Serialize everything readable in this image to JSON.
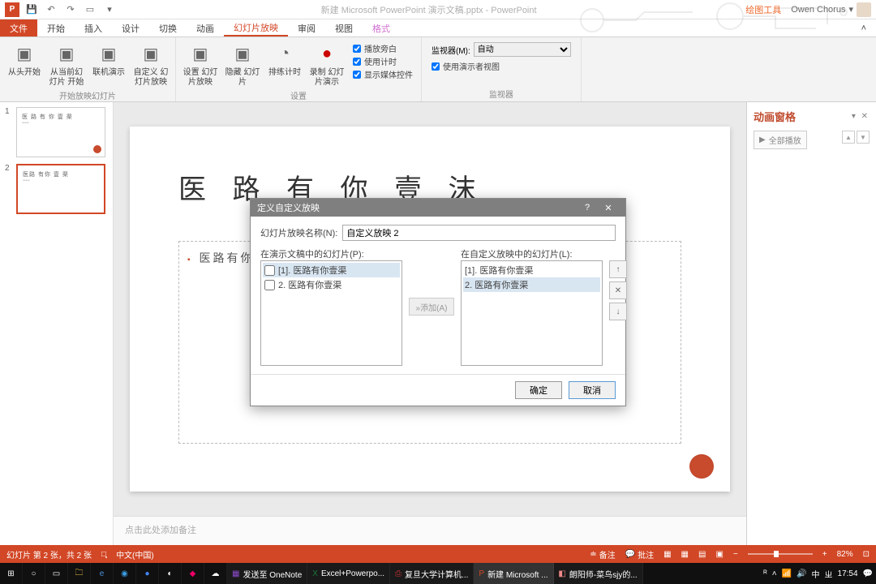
{
  "titlebar": {
    "doc_title": "新建 Microsoft PowerPoint 演示文稿.pptx - PowerPoint",
    "tool_context": "绘图工具",
    "user": "Owen Chorus"
  },
  "tabs": {
    "file": "文件",
    "items": [
      "开始",
      "插入",
      "设计",
      "切换",
      "动画",
      "幻灯片放映",
      "审阅",
      "视图"
    ],
    "format": "格式",
    "active": "幻灯片放映"
  },
  "ribbon": {
    "group1": {
      "btns": [
        {
          "label": "从头开始"
        },
        {
          "label": "从当前幻灯片\n开始"
        },
        {
          "label": "联机演示"
        },
        {
          "label": "自定义\n幻灯片放映"
        }
      ],
      "label": "开始放映幻灯片"
    },
    "group2": {
      "btns": [
        {
          "label": "设置\n幻灯片放映"
        },
        {
          "label": "隐藏\n幻灯片"
        },
        {
          "label": "排练计时"
        },
        {
          "label": "录制\n幻灯片演示"
        }
      ],
      "checks": [
        "播放旁白",
        "使用计时",
        "显示媒体控件"
      ],
      "label": "设置"
    },
    "group3": {
      "monitor_label": "监视器(M):",
      "monitor_value": "自动",
      "presenter_view": "使用演示者视图",
      "label": "监视器"
    }
  },
  "thumbnails": [
    {
      "num": "1",
      "title": "医 路 有 你 壹 渠"
    },
    {
      "num": "2",
      "title": "医路 有你 壹 渠"
    }
  ],
  "slide": {
    "title": "医 路 有 你 壹 沫",
    "body": "医路有你壹"
  },
  "notes_placeholder": "点击此处添加备注",
  "anim_pane": {
    "title": "动画窗格",
    "play_all": "全部播放"
  },
  "statusbar": {
    "slide_info": "幻灯片 第 2 张，共 2 张",
    "lang": "中文(中国)",
    "notes": "备注",
    "comments": "批注",
    "zoom": "82%"
  },
  "taskbar": {
    "apps": [
      "发送至 OneNote",
      "Excel+Powerpo...",
      "复旦大学计算机...",
      "新建 Microsoft ...",
      "朗阳师-菜鸟sjy的..."
    ],
    "time": "17:54"
  },
  "dialog": {
    "title": "定义自定义放映",
    "name_label": "幻灯片放映名称(N):",
    "name_value": "自定义放映 2",
    "left_label": "在演示文稿中的幻灯片(P):",
    "left_items": [
      "[1]. 医路有你壹渠",
      "2. 医路有你壹渠"
    ],
    "right_label": "在自定义放映中的幻灯片(L):",
    "right_items": [
      "[1]. 医路有你壹渠",
      "2. 医路有你壹渠"
    ],
    "add_btn": "添加(A)",
    "ok": "确定",
    "cancel": "取消"
  }
}
